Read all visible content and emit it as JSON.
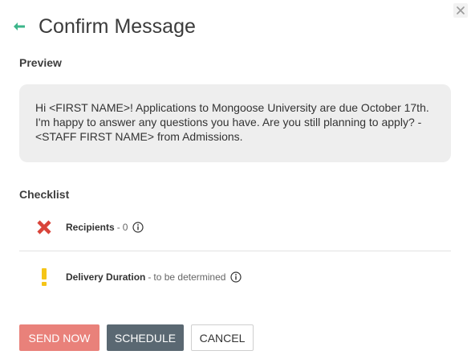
{
  "dialog": {
    "title": "Confirm Message"
  },
  "preview": {
    "label": "Preview",
    "message": "Hi <FIRST NAME>!  Applications to Mongoose University are due October 17th. I'm happy to answer any questions you have. Are you still planning to apply? - <STAFF FIRST NAME> from Admissions."
  },
  "checklist": {
    "label": "Checklist",
    "items": [
      {
        "name": "Recipients",
        "separator": "-",
        "value": "0",
        "status_icon": "x-error-icon",
        "status_color": "#d9443a"
      },
      {
        "name": "Delivery Duration",
        "separator": "-",
        "value": "to be determined",
        "status_icon": "exclamation-warning-icon",
        "status_color": "#f5c518"
      }
    ]
  },
  "buttons": {
    "send_now": "SEND NOW",
    "schedule": "SCHEDULE",
    "cancel": "CANCEL"
  },
  "colors": {
    "accent_green": "#3bb58a",
    "send_now_bg": "#e9817a",
    "schedule_bg": "#5a6872",
    "preview_bg": "#eeeeee"
  }
}
